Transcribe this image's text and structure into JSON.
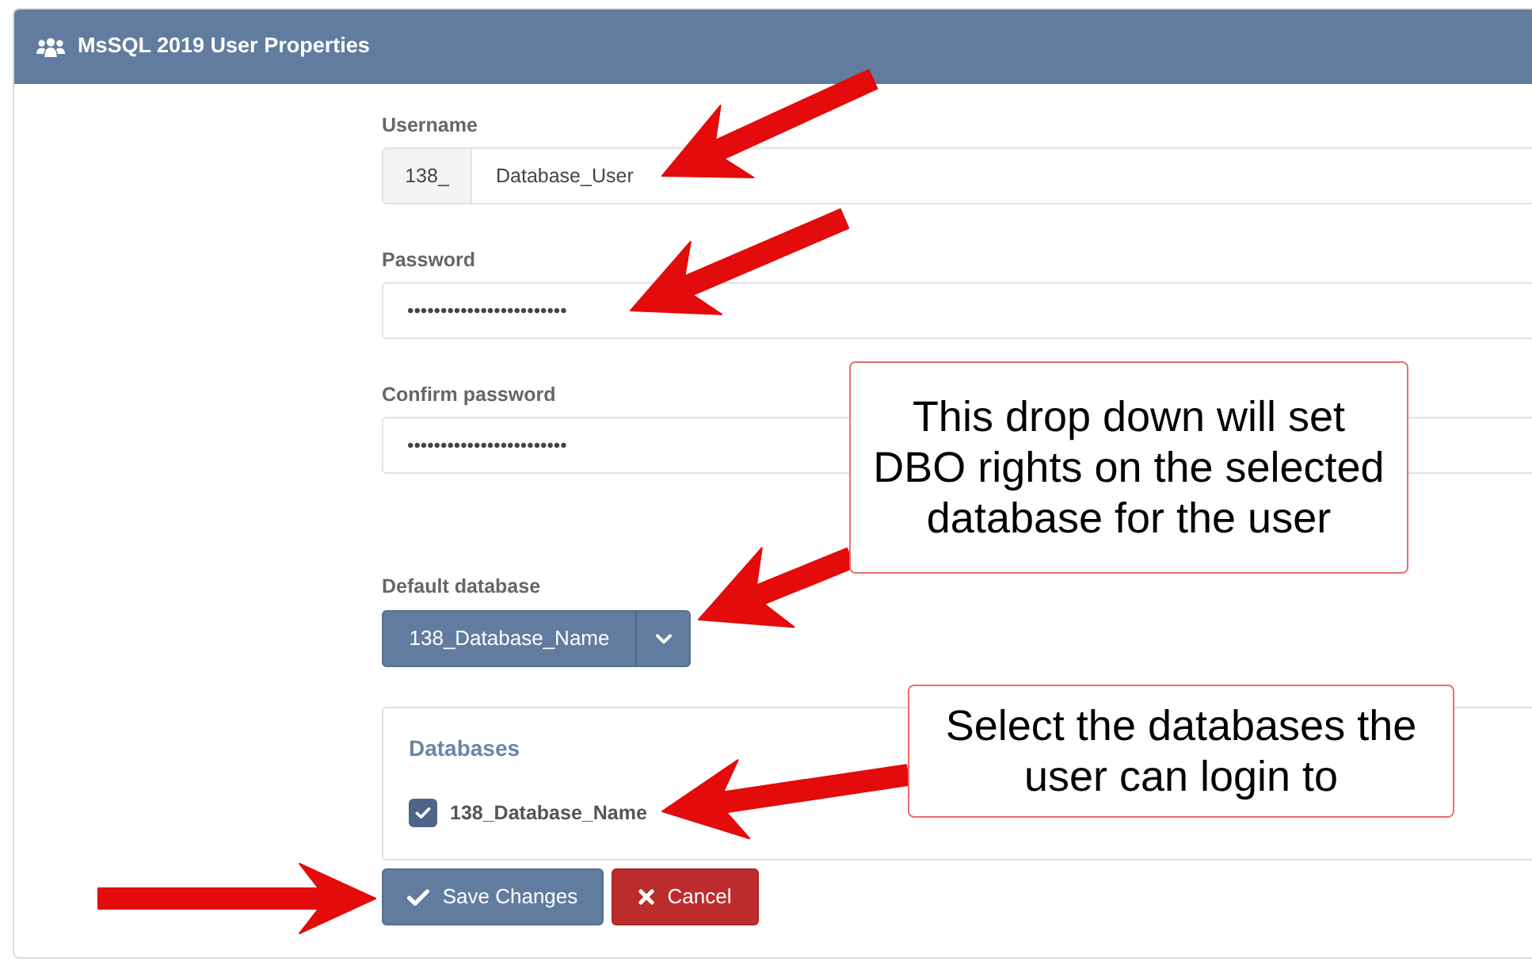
{
  "window": {
    "title": "MsSQL 2019 User Properties"
  },
  "form": {
    "username": {
      "label": "Username",
      "prefix": "138_",
      "value": "Database_User"
    },
    "password": {
      "label": "Password",
      "value": "••••••••••••••••••••••••"
    },
    "confirm_password": {
      "label": "Confirm password",
      "value": "••••••••••••••••••••••••"
    },
    "default_database": {
      "label": "Default database",
      "value": "138_Database_Name"
    },
    "databases": {
      "legend": "Databases",
      "items": [
        {
          "label": "138_Database_Name",
          "checked": true
        }
      ]
    }
  },
  "buttons": [
    {
      "label": "Save Changes",
      "kind": "save"
    },
    {
      "label": "Cancel",
      "kind": "cancel"
    }
  ],
  "annotations": [
    {
      "text": "This drop down will set DBO rights on the selected database for the user"
    },
    {
      "text": "Select the databases the user can login to"
    }
  ]
}
